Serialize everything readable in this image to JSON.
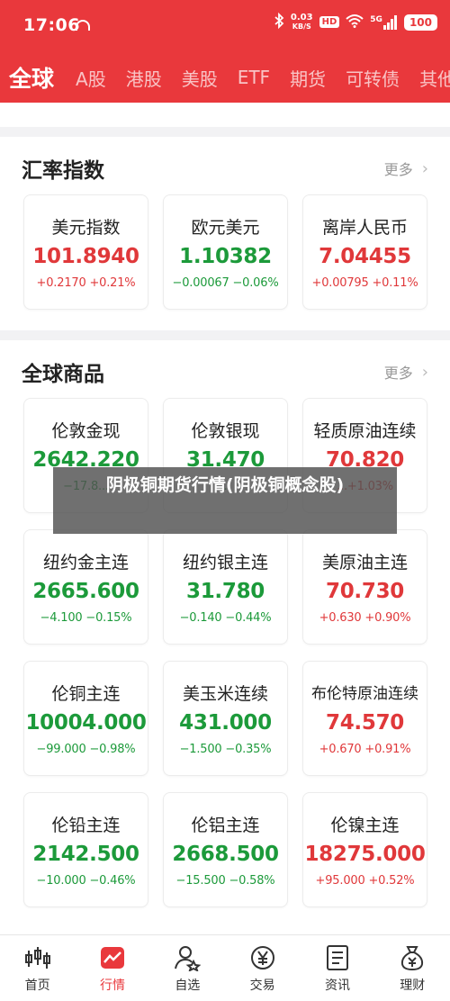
{
  "status": {
    "time": "17:06",
    "speed_value": "0.03",
    "speed_unit": "KB/S",
    "hd": "HD",
    "network": "5G",
    "battery": "100"
  },
  "tabs": [
    "全球",
    "A股",
    "港股",
    "美股",
    "ETF",
    "期货",
    "可转债",
    "其他"
  ],
  "fx_section": {
    "title": "汇率指数",
    "more": "更多",
    "cards": [
      {
        "name": "美元指数",
        "price": "101.8940",
        "change": "+0.2170  +0.21%",
        "trend": "up"
      },
      {
        "name": "欧元美元",
        "price": "1.10382",
        "change": "−0.00067  −0.06%",
        "trend": "down"
      },
      {
        "name": "离岸人民币",
        "price": "7.04455",
        "change": "+0.00795  +0.11%",
        "trend": "up"
      }
    ]
  },
  "commodity_section": {
    "title": "全球商品",
    "more": "更多",
    "cards": [
      {
        "name": "伦敦金现",
        "price": "2642.220",
        "change": "−17.8...",
        "trend": "down"
      },
      {
        "name": "伦敦银现",
        "price": "31.470",
        "change": "...",
        "trend": "down"
      },
      {
        "name": "轻质原油连续",
        "price": "70.820",
        "change": "...+1.03%",
        "trend": "up"
      },
      {
        "name": "纽约金主连",
        "price": "2665.600",
        "change": "−4.100  −0.15%",
        "trend": "down"
      },
      {
        "name": "纽约银主连",
        "price": "31.780",
        "change": "−0.140  −0.44%",
        "trend": "down"
      },
      {
        "name": "美原油主连",
        "price": "70.730",
        "change": "+0.630  +0.90%",
        "trend": "up"
      },
      {
        "name": "伦铜主连",
        "price": "10004.000",
        "change": "−99.000  −0.98%",
        "trend": "down"
      },
      {
        "name": "美玉米连续",
        "price": "431.000",
        "change": "−1.500  −0.35%",
        "trend": "down"
      },
      {
        "name": "布伦特原油连续",
        "price": "74.570",
        "change": "+0.670  +0.91%",
        "trend": "up"
      },
      {
        "name": "伦铅主连",
        "price": "2142.500",
        "change": "−10.000  −0.46%",
        "trend": "down"
      },
      {
        "name": "伦铝主连",
        "price": "2668.500",
        "change": "−15.500  −0.58%",
        "trend": "down"
      },
      {
        "name": "伦镍主连",
        "price": "18275.000",
        "change": "+95.000  +0.52%",
        "trend": "up"
      }
    ]
  },
  "overlay_text": "阴极铜期货行情(阴极铜概念股)",
  "bottom_nav": [
    {
      "label": "首页",
      "icon": "chart-candle-icon",
      "active": false
    },
    {
      "label": "行情",
      "icon": "market-trend-icon",
      "active": true
    },
    {
      "label": "自选",
      "icon": "user-star-icon",
      "active": false
    },
    {
      "label": "交易",
      "icon": "yen-coin-icon",
      "active": false
    },
    {
      "label": "资讯",
      "icon": "news-doc-icon",
      "active": false
    },
    {
      "label": "理财",
      "icon": "money-bag-icon",
      "active": false
    }
  ],
  "colors": {
    "brand_red": "#e9383c",
    "up": "#e0383a",
    "down": "#1c9a3a"
  }
}
